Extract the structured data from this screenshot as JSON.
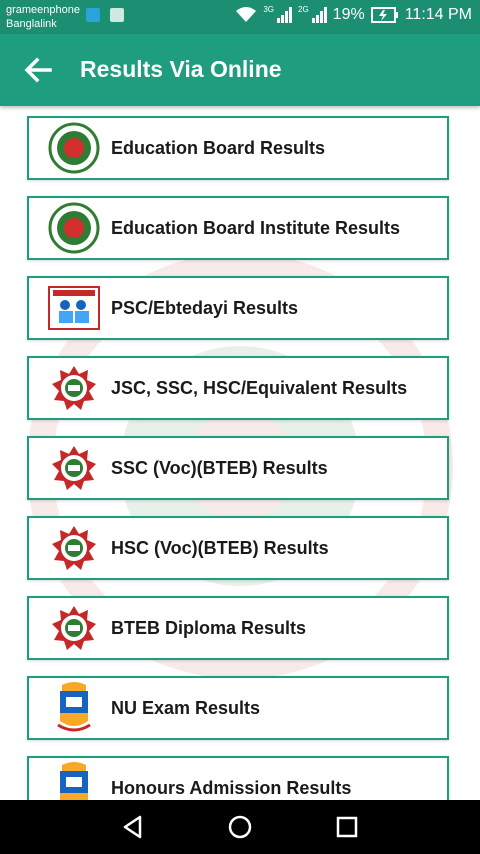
{
  "status_bar": {
    "carrier_1": "grameenphone",
    "carrier_2": "Banglalink",
    "net_1": "3G",
    "net_2": "2G",
    "battery": "19%",
    "time": "11:14 PM"
  },
  "app_bar": {
    "title": "Results Via Online",
    "back_icon": "arrow-left-icon",
    "color": "#1f9e7f"
  },
  "colors": {
    "accent": "#1f9e7f",
    "status_bar": "#1c8f73"
  },
  "items": [
    {
      "label": "Education Board Results",
      "icon": "education-board-logo-icon"
    },
    {
      "label": "Education Board Institute Results",
      "icon": "education-board-logo-icon"
    },
    {
      "label": "PSC/Ebtedayi Results",
      "icon": "primary-education-logo-icon"
    },
    {
      "label": "JSC, SSC, HSC/Equivalent Results",
      "icon": "bteb-logo-icon"
    },
    {
      "label": "SSC (Voc)(BTEB) Results",
      "icon": "bteb-logo-icon"
    },
    {
      "label": "HSC (Voc)(BTEB) Results",
      "icon": "bteb-logo-icon"
    },
    {
      "label": "BTEB Diploma Results",
      "icon": "bteb-logo-icon"
    },
    {
      "label": "NU Exam Results",
      "icon": "national-university-logo-icon"
    },
    {
      "label": "Honours Admission Results",
      "icon": "national-university-logo-icon"
    }
  ],
  "nav_bar": {
    "back": "back-triangle-icon",
    "home": "home-circle-icon",
    "recents": "recents-square-icon"
  }
}
